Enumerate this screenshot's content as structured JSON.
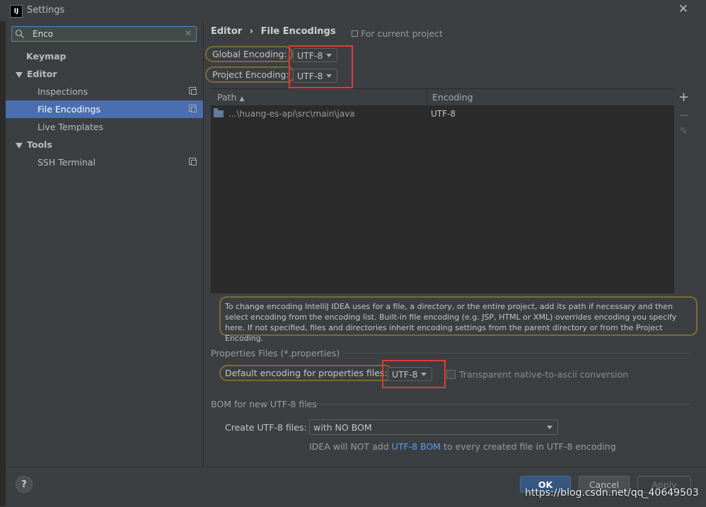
{
  "window": {
    "title": "Settings",
    "app_icon_text": "IJ"
  },
  "search": {
    "value": "Enco"
  },
  "sidebar": {
    "items": [
      {
        "label": "Keymap"
      },
      {
        "label": "Editor"
      },
      {
        "label": "Inspections"
      },
      {
        "label": "File Encodings"
      },
      {
        "label": "Live Templates"
      },
      {
        "label": "Tools"
      },
      {
        "label": "SSH Terminal"
      }
    ]
  },
  "breadcrumb": {
    "parent": "Editor",
    "separator": "›",
    "current": "File Encodings",
    "scope": "For current project"
  },
  "encoding": {
    "global_label": "Global Encoding:",
    "global_value": "UTF-8",
    "project_label": "Project Encoding:",
    "project_value": "UTF-8"
  },
  "table": {
    "columns": [
      "Path",
      "Encoding"
    ],
    "rows": [
      {
        "path": "...\\huang-es-api\\src\\main\\java",
        "encoding": "UTF-8"
      }
    ]
  },
  "toolbar": {
    "add": "+",
    "remove": "−",
    "edit": "✎"
  },
  "info_text": "To change encoding IntelliJ IDEA uses for a file, a directory, or the entire project, add its path if necessary and then select encoding from the encoding list. Built-in file encoding (e.g. JSP, HTML or XML) overrides encoding you specify here. If not specified, files and directories inherit encoding settings from the parent directory or from the Project Encoding.",
  "properties": {
    "section_title": "Properties Files (*.properties)",
    "default_label": "Default encoding for properties files:",
    "default_value": "UTF-8",
    "transparent_label": "Transparent native-to-ascii conversion"
  },
  "bom": {
    "section_title": "BOM for new UTF-8 files",
    "create_label": "Create UTF-8 files:",
    "create_value": "with NO BOM",
    "note_prefix": "IDEA will NOT add",
    "note_link": "UTF-8 BOM",
    "note_suffix": "to every created file in UTF-8 encoding"
  },
  "buttons": {
    "help": "?",
    "ok": "OK",
    "cancel": "Cancel",
    "apply": "Apply"
  },
  "watermark": "https://blog.csdn.net/qq_40649503",
  "colors": {
    "selection": "#4b6eaf",
    "highlight": "#e53935",
    "outline": "#7a6a3b",
    "link": "#589df6"
  }
}
